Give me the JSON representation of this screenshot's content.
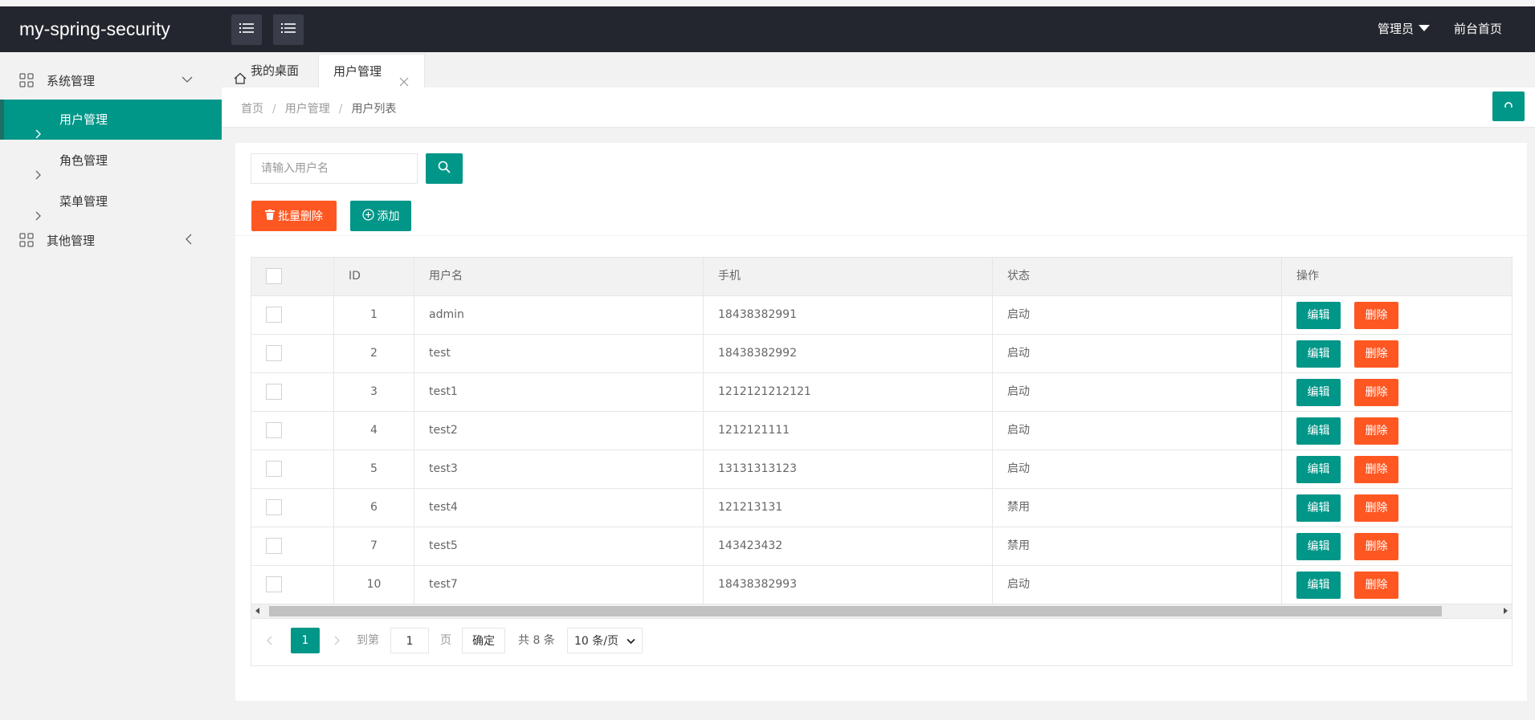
{
  "app": {
    "title": "my-spring-security"
  },
  "header": {
    "user_label": "管理员",
    "home_link": "前台首页",
    "toggle_icon_1": "list-icon",
    "toggle_icon_2": "list-icon"
  },
  "sidebar": {
    "groups": [
      {
        "label": "系统管理",
        "icon": "grid-icon",
        "expanded": true,
        "items": [
          {
            "label": "用户管理",
            "active": true
          },
          {
            "label": "角色管理",
            "active": false
          },
          {
            "label": "菜单管理",
            "active": false
          }
        ]
      },
      {
        "label": "其他管理",
        "icon": "grid-icon",
        "expanded": false,
        "items": []
      }
    ]
  },
  "tabs": [
    {
      "label": "我的桌面",
      "icon": "home-icon",
      "active": false
    },
    {
      "label": "用户管理",
      "active": true,
      "closable": true
    }
  ],
  "breadcrumb": {
    "items": [
      "首页",
      "用户管理"
    ],
    "current": "用户列表",
    "separator": "/"
  },
  "toolbar": {
    "search_placeholder": "请输入用户名",
    "batch_delete_label": "批量删除",
    "add_label": "添加"
  },
  "table": {
    "columns": [
      "ID",
      "用户名",
      "手机",
      "状态",
      "操作"
    ],
    "edit_label": "编辑",
    "delete_label": "删除",
    "rows": [
      {
        "id": "1",
        "username": "admin",
        "phone": "18438382991",
        "status": "启动"
      },
      {
        "id": "2",
        "username": "test",
        "phone": "18438382992",
        "status": "启动"
      },
      {
        "id": "3",
        "username": "test1",
        "phone": "1212121212121",
        "status": "启动"
      },
      {
        "id": "4",
        "username": "test2",
        "phone": "1212121111",
        "status": "启动"
      },
      {
        "id": "5",
        "username": "test3",
        "phone": "13131313123",
        "status": "启动"
      },
      {
        "id": "6",
        "username": "test4",
        "phone": "121213131",
        "status": "禁用"
      },
      {
        "id": "7",
        "username": "test5",
        "phone": "143423432",
        "status": "禁用"
      },
      {
        "id": "10",
        "username": "test7",
        "phone": "18438382993",
        "status": "启动"
      }
    ]
  },
  "pager": {
    "current_page": "1",
    "goto_label": "到第",
    "goto_value": "1",
    "page_unit": "页",
    "confirm_label": "确定",
    "total_text": "共 8 条",
    "page_size_option": "10 条/页"
  },
  "colors": {
    "accent": "#009688",
    "danger": "#ff5722",
    "header_bg": "#23262e"
  }
}
